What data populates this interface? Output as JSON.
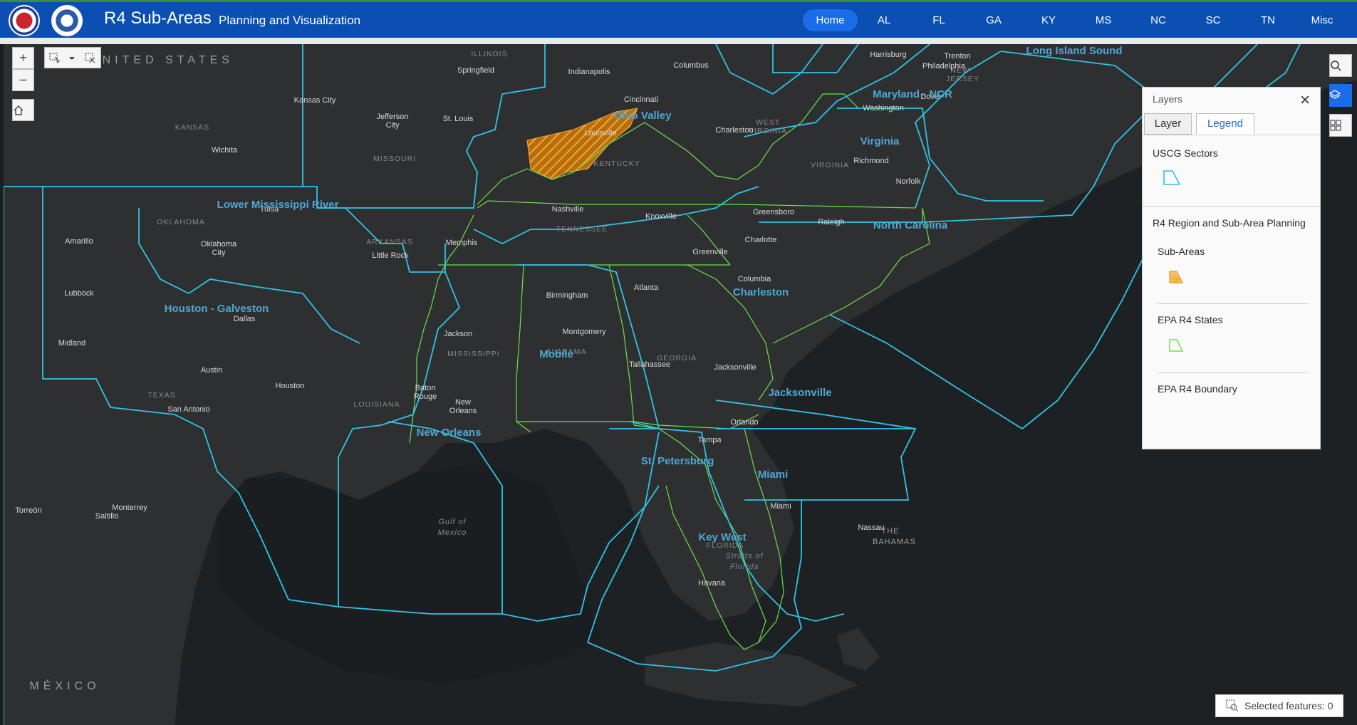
{
  "header": {
    "title": "R4 Sub-Areas",
    "subtitle": "Planning and Visualization",
    "nav": [
      "Home",
      "AL",
      "FL",
      "GA",
      "KY",
      "MS",
      "NC",
      "SC",
      "TN",
      "Misc"
    ],
    "active_nav": "Home",
    "colors": {
      "bar": "#0c4fb3",
      "active": "#1a6ce8"
    }
  },
  "map": {
    "colors": {
      "sector": "#2ec4e8",
      "state": "#6be24b",
      "subarea": "#f29b1d",
      "land": "#2e2f31",
      "water": "#1b1e21"
    },
    "labels": {
      "country_us": "UNITED STATES",
      "country_mx": "MÉXICO",
      "states": [
        "ILLINOIS",
        "KANSAS",
        "MISSOURI",
        "OKLAHOMA",
        "ARKANSAS",
        "TEXAS",
        "LOUISIANA",
        "MISSISSIPPI",
        "ALABAMA",
        "GEORGIA",
        "FLORIDA",
        "TENNESSEE",
        "KENTUCKY",
        "WEST VIRGINIA",
        "VIRGINIA",
        "NEW JERSEY"
      ],
      "cities": [
        "Springfield",
        "Indianapolis",
        "Columbus",
        "Harrisburg",
        "Trenton",
        "Philadelphia",
        "Kansas City",
        "Jefferson City",
        "St. Louis",
        "Cincinnati",
        "Louisville",
        "Charleston",
        "Washington",
        "Dover",
        "Wichita",
        "Richmond",
        "Norfolk",
        "Tulsa",
        "Oklahoma City",
        "Nashville",
        "Knoxville",
        "Greensboro",
        "Raleigh",
        "Amarillo",
        "Memphis",
        "Little Rock",
        "Charlotte",
        "Greenville",
        "Columbia",
        "Lubbock",
        "Birmingham",
        "Atlanta",
        "Dallas",
        "Jackson",
        "Montgomery",
        "Midland",
        "Baton Rouge",
        "New Orleans",
        "Tallahassee",
        "Jacksonville",
        "Austin",
        "Houston",
        "San Antonio",
        "Orlando",
        "Tampa",
        "Miami",
        "Nassau",
        "Havana",
        "Torreón",
        "Monterrey",
        "Saltillo"
      ],
      "water": [
        "Gulf of Mexico",
        "Straits of Florida",
        "THE BAHAMAS"
      ],
      "sub_areas": [
        "Ohio Valley",
        "Maryland - NCR",
        "Long Island Sound",
        "Virginia",
        "Lower Mississippi River",
        "North Carolina",
        "Houston - Galveston",
        "Charleston",
        "Mobile",
        "Jacksonville",
        "New Orleans",
        "St. Petersburg",
        "Miami",
        "Key West"
      ]
    }
  },
  "tools": {
    "zoom_in": "+",
    "zoom_out": "–",
    "home": "home-icon",
    "select": "select-icon",
    "clear_selection": "clear-selection-icon"
  },
  "layers_panel": {
    "title": "Layers",
    "tabs": [
      "Layer",
      "Legend"
    ],
    "active_tab": "Legend",
    "legend": {
      "uscg_sectors": "USCG Sectors",
      "group": "R4 Region and Sub-Area Planning",
      "sub_areas": "Sub-Areas",
      "epa_states": "EPA R4 States",
      "epa_boundary": "EPA R4 Boundary"
    }
  },
  "status": {
    "selected_features": "Selected features: 0"
  }
}
